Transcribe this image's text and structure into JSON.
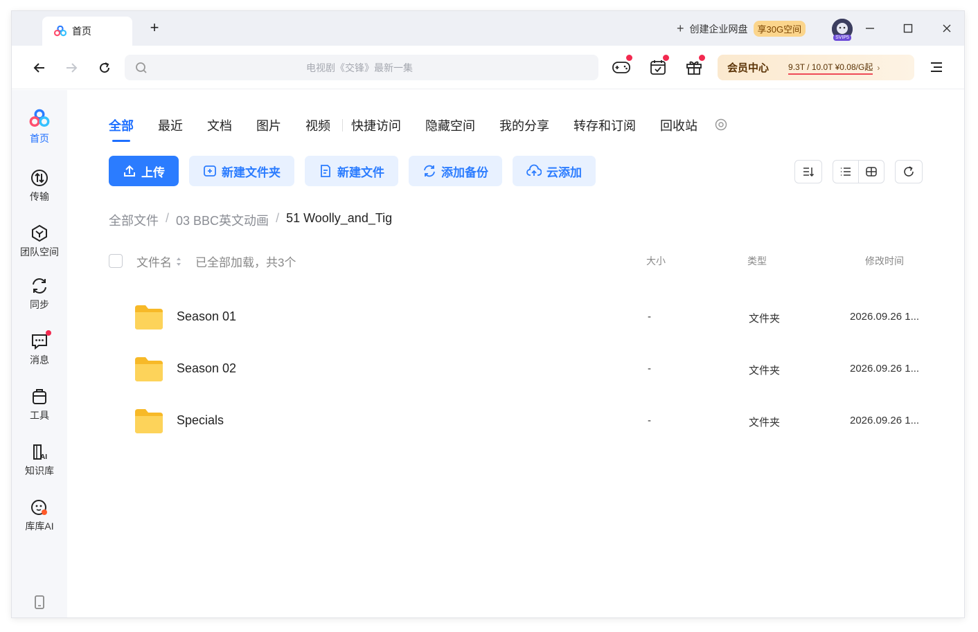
{
  "titlebar": {
    "tab_label": "首页",
    "new_tab": "+",
    "enterprise": {
      "plus": "+",
      "label": "创建企业网盘",
      "badge": "享30G空间"
    },
    "avatar_badge": "SVIP5"
  },
  "nav": {
    "search_placeholder": "电视剧《交锋》最新一集",
    "vip": {
      "title": "会员中心",
      "info": "9.3T / 10.0T  ¥0.08/G起",
      "arrow": "›"
    }
  },
  "sidebar": {
    "items": [
      {
        "label": "首页",
        "icon": "home-logo-icon",
        "active": true
      },
      {
        "label": "传输",
        "icon": "transfer-icon"
      },
      {
        "label": "团队空间",
        "icon": "team-space-icon"
      },
      {
        "label": "同步",
        "icon": "sync-icon"
      },
      {
        "label": "消息",
        "icon": "message-icon",
        "dot": true
      },
      {
        "label": "工具",
        "icon": "tools-icon"
      },
      {
        "label": "知识库",
        "icon": "knowledge-ai-icon"
      },
      {
        "label": "库库AI",
        "icon": "kuku-ai-icon"
      }
    ]
  },
  "tabs": [
    "全部",
    "最近",
    "文档",
    "图片",
    "视频",
    "快捷访问",
    "隐藏空间",
    "我的分享",
    "转存和订阅",
    "回收站"
  ],
  "actions": {
    "upload": "上传",
    "new_folder": "新建文件夹",
    "new_file": "新建文件",
    "add_backup": "添加备份",
    "cloud_add": "云添加"
  },
  "breadcrumb": [
    "全部文件",
    "03 BBC英文动画",
    "51 Woolly_and_Tig"
  ],
  "table": {
    "col_name": "文件名",
    "loaded_text": "已全部加载，共3个",
    "col_size": "大小",
    "col_type": "类型",
    "col_time": "修改时间",
    "rows": [
      {
        "name": "Season 01",
        "size": "-",
        "type": "文件夹",
        "time": "2026.09.26 1..."
      },
      {
        "name": "Season 02",
        "size": "-",
        "type": "文件夹",
        "time": "2026.09.26 1..."
      },
      {
        "name": "Specials",
        "size": "-",
        "type": "文件夹",
        "time": "2026.09.26 1..."
      }
    ]
  },
  "colors": {
    "accent": "#2b7cff",
    "light_button": "#e8f1ff",
    "red_dot": "#f2294f",
    "folder": "#fbc93c",
    "vip_text": "#5a3205"
  }
}
